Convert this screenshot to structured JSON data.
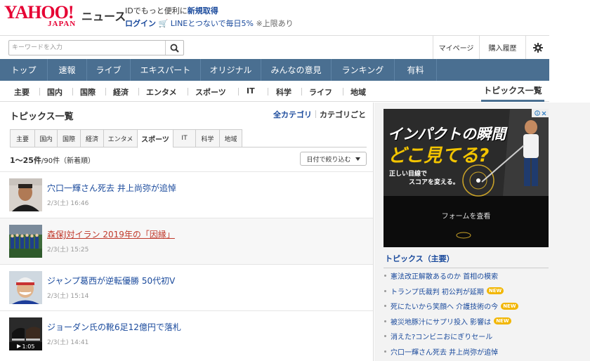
{
  "header": {
    "logo_main": "YAHOO!",
    "logo_sub": "JAPAN",
    "logo_news": "ニュース",
    "promo_text": "IDでもっと便利に",
    "promo_link": "新規取得",
    "login": "ログイン",
    "line_promo": "LINEとつないで毎日5%",
    "line_note": "※上限あり"
  },
  "search": {
    "placeholder": "キーワードを入力"
  },
  "utility": {
    "mypage": "マイページ",
    "history": "購入履歴"
  },
  "main_nav": [
    {
      "label": "トップ",
      "active": true
    },
    {
      "label": "速報",
      "active": false
    },
    {
      "label": "ライブ",
      "active": false
    },
    {
      "label": "エキスパート",
      "active": false
    },
    {
      "label": "オリジナル",
      "active": false
    },
    {
      "label": "みんなの意見",
      "active": false
    },
    {
      "label": "ランキング",
      "active": false
    },
    {
      "label": "有料",
      "active": false
    }
  ],
  "sub_nav": [
    "主要",
    "国内",
    "国際",
    "経済",
    "エンタメ",
    "スポーツ",
    "IT",
    "科学",
    "ライフ",
    "地域"
  ],
  "sub_nav_active": "トピックス一覧",
  "section": {
    "title": "トピックス一覧",
    "all_categories": "全カテゴリ",
    "each_category": "カテゴリごと"
  },
  "category_tabs": [
    {
      "label": "主要",
      "active": false
    },
    {
      "label": "国内",
      "active": false
    },
    {
      "label": "国際",
      "active": false
    },
    {
      "label": "経済",
      "active": false
    },
    {
      "label": "エンタメ",
      "active": false
    },
    {
      "label": "スポーツ",
      "active": true
    },
    {
      "label": "IT",
      "active": false
    },
    {
      "label": "科学",
      "active": false
    },
    {
      "label": "地域",
      "active": false
    }
  ],
  "listing": {
    "count_bold": "1〜25件",
    "count_rest": "/90件（新着順）",
    "filter_label": "日付で絞り込む"
  },
  "articles": [
    {
      "title": "穴口一輝さん死去 井上尚弥が追悼",
      "date": "2/3(土) 16:46"
    },
    {
      "title": "森保J対イラン 2019年の「因縁」",
      "date": "2/3(土) 15:25"
    },
    {
      "title": "ジャンプ葛西が逆転優勝 50代初V",
      "date": "2/3(土) 15:14"
    },
    {
      "title": "ジョーダン氏の靴6足12億円で落札",
      "date": "2/3(土) 14:41",
      "video": "1:05"
    }
  ],
  "ad": {
    "headline1": "インパクトの瞬間",
    "headline2": "どこ見てる?",
    "sub1": "正しい目線で",
    "sub2": "スコアを変える。",
    "cta": "フォームを査看"
  },
  "topics": {
    "title": "トピックス（主要）",
    "items": [
      {
        "text": "憲法改正解散あるのか 首相の模索",
        "new": false
      },
      {
        "text": "トランプ氏裁判 初公判が延期",
        "new": true
      },
      {
        "text": "死にたいから笑顔へ 介護技術の今",
        "new": true
      },
      {
        "text": "被災地豚汁にサプリ投入 影響は",
        "new": true
      },
      {
        "text": "消えた?コンビニおにぎりセール",
        "new": false
      },
      {
        "text": "穴口一輝さん死去 井上尚弥が追悼",
        "new": false
      }
    ],
    "new_label": "NEW"
  },
  "colors": {
    "brand_red": "#e60033",
    "nav_bg": "#4a6f91",
    "nav_active": "#2b455e",
    "link_blue": "#1a4a9c",
    "new_badge": "#f2b600"
  }
}
